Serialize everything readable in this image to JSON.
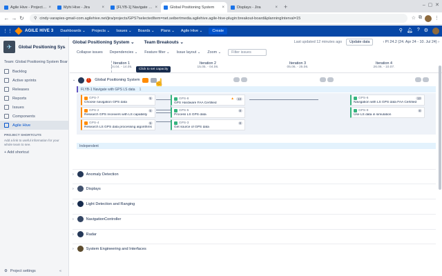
{
  "browser": {
    "tabs": [
      {
        "label": "Agile Hive - Project Hierarchy",
        "active": false
      },
      {
        "label": "Myhi Hive - Jira",
        "active": false
      },
      {
        "label": "[FLYB-1] Navigate with GPS",
        "active": false
      },
      {
        "label": "Global Positioning System",
        "active": true
      },
      {
        "label": "Displays - Jira",
        "active": false
      }
    ],
    "url": "cindy-varapies-gmail-com.agilehive.net/jira/projects/GPS?selectedItem=net.seibertmedia.agilehive.agile-hive-plugin:breakout-board&planningInterval=15"
  },
  "jira_nav": {
    "brand": "AGILE HIVE 3",
    "menus": [
      "Dashboards ⌄",
      "Projects ⌄",
      "Issues ⌄",
      "Boards ⌄",
      "Plans ⌄",
      "Agile Hive ⌄"
    ],
    "create_label": "Create"
  },
  "sidebar": {
    "project_name": "Global Positioning Sys...",
    "board_label": "Team: Global Positioning System Boar",
    "items": [
      {
        "label": "Backlog",
        "active": false
      },
      {
        "label": "Active sprints",
        "active": false
      },
      {
        "label": "Releases",
        "active": false
      },
      {
        "label": "Reports",
        "active": false
      },
      {
        "label": "Issues",
        "active": false
      },
      {
        "label": "Components",
        "active": false
      },
      {
        "label": "Agile Hive",
        "active": true
      }
    ],
    "shortcuts_heading": "Project shortcuts",
    "shortcuts_text": "Add a link to useful information for your whole team to see.",
    "add_shortcut": "+ Add shortcut",
    "project_settings": "Project settings"
  },
  "header": {
    "project_title": "Global Positioning System ⌄",
    "board_title": "Team Breakouts ⌄",
    "last_updated": "Last updated 12 minutes ago",
    "update_button": "Update data",
    "pi_selector": "PI 24.2 (24. Apr 24 - 10. Jul 24)"
  },
  "filters": {
    "items": [
      "Collapse issues",
      "Dependencies ⌄",
      "Feature filter ⌄",
      "Issue layout ⌄",
      "Zoom ⌄"
    ],
    "search_placeholder": "Filter issues"
  },
  "iterations": [
    {
      "name": "Iteration 1",
      "dates": "24.04. - 14.05."
    },
    {
      "name": "Iteration 2",
      "dates": "15.05. - 04.06."
    },
    {
      "name": "Iteration 3",
      "dates": "05.06. - 25.06."
    },
    {
      "name": "Iteration 4",
      "dates": "26.06. - 10.07."
    }
  ],
  "team_row": {
    "name": "Global Positioning System",
    "tooltip": "Click to set capacity"
  },
  "epic": {
    "label": "FLYB-1 Navigate with GPS LS data",
    "count": "1"
  },
  "cards": [
    {
      "key": "GPS-7",
      "summary": "Choose navigation GPS data",
      "points": "5",
      "type": "story",
      "warn": false
    },
    {
      "key": "GPS-2",
      "summary": "Research GPS receivers with LS capability",
      "points": "5",
      "type": "story",
      "warn": false
    },
    {
      "key": "GPS-4",
      "summary": "Research LS GPS data processing algorithms an...",
      "points": "5",
      "type": "story",
      "warn": false
    },
    {
      "key": "GPS-8",
      "summary": "GPS Hardware FAA Certified",
      "points": "13",
      "type": "task",
      "warn": true
    },
    {
      "key": "GPS-5",
      "summary": "Process LS GPS data",
      "points": "8",
      "type": "task",
      "warn": false
    },
    {
      "key": "GPS-3",
      "summary": "Get source of GPS data",
      "points": "8",
      "type": "task",
      "warn": false
    },
    {
      "key": "GPS-6",
      "summary": "Navigation with LS GPS data FAA Certified",
      "points": "13",
      "type": "task",
      "warn": false
    },
    {
      "key": "GPS-9",
      "summary": "Use LS data in simulation",
      "points": "8",
      "type": "task",
      "warn": false
    }
  ],
  "independent_label": "Independent",
  "teams": [
    {
      "name": "Anomaly Detection",
      "color": "#253858"
    },
    {
      "name": "Displays",
      "color": "#42526e"
    },
    {
      "name": "Light Detection and Ranging",
      "color": "#172b4d"
    },
    {
      "name": "NavigationController",
      "color": "#344563"
    },
    {
      "name": "Radar",
      "color": "#253858"
    },
    {
      "name": "System Engineering and Interfaces",
      "color": "#5e4d2f"
    }
  ]
}
